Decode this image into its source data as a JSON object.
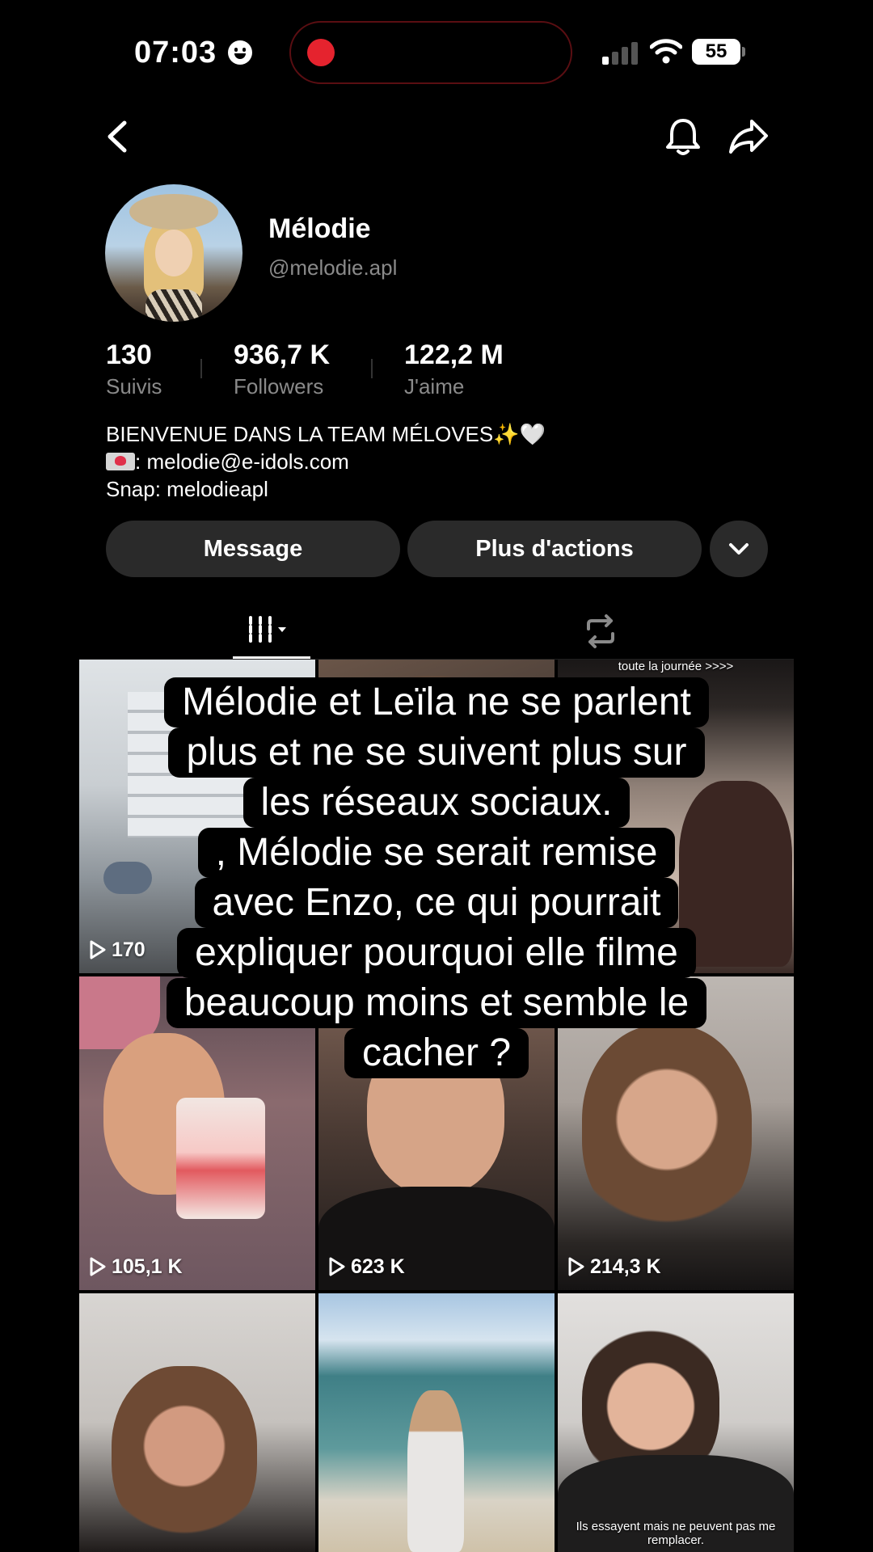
{
  "status_bar": {
    "time": "07:03",
    "battery": "55"
  },
  "profile": {
    "name": "Mélodie",
    "handle": "@melodie.apl",
    "stats": [
      {
        "value": "130",
        "label": "Suivis"
      },
      {
        "value": "936,7 K",
        "label": "Followers"
      },
      {
        "value": "122,2 M",
        "label": "J'aime"
      }
    ],
    "bio": {
      "line1": "BIENVENUE DANS LA TEAM MÉLOVES✨🤍",
      "email": ": melodie@e-idols.com",
      "snap": "Snap: melodieapl"
    }
  },
  "actions": {
    "message": "Message",
    "more": "Plus d'actions"
  },
  "grid": {
    "tiles": [
      {
        "views": "170",
        "caption": ""
      },
      {
        "views": "",
        "caption": ""
      },
      {
        "views": "",
        "caption": "toute la journée >>>>"
      },
      {
        "views": "105,1 K",
        "caption": ""
      },
      {
        "views": "623 K",
        "caption": ""
      },
      {
        "views": "214,3 K",
        "caption": ""
      },
      {
        "views": "",
        "caption": ""
      },
      {
        "views": "",
        "caption": ""
      },
      {
        "views": "",
        "caption": "Ils essayent mais ne peuvent pas me remplacer."
      }
    ]
  },
  "overlay_text": [
    "Mélodie et Leïla ne se parlent",
    "plus et ne se suivent plus sur",
    "les réseaux sociaux.",
    ", Mélodie se serait remise",
    "avec Enzo, ce qui pourrait",
    "expliquer pourquoi elle filme",
    "beaucoup moins et semble le",
    "cacher ?"
  ],
  "colors": {
    "background": "#000000",
    "button": "#2a2a2a",
    "muted_text": "#8a8a8a",
    "record": "#e5232e"
  },
  "icons": [
    "back-arrow-icon",
    "bell-icon",
    "share-icon",
    "chevron-down-icon",
    "grid-icon",
    "repost-icon",
    "play-icon"
  ]
}
